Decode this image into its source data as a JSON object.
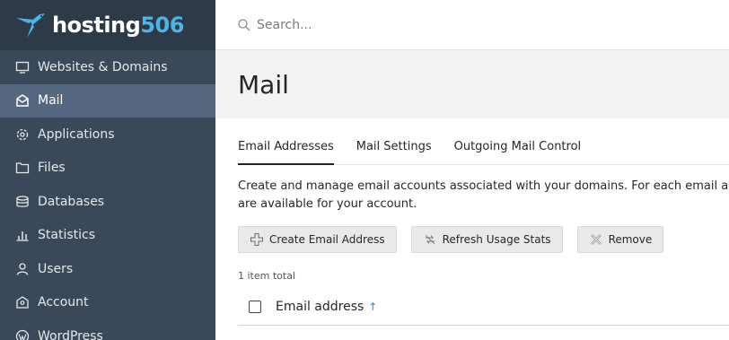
{
  "brand": {
    "name": "hosting",
    "number": "506"
  },
  "sidebar": {
    "items": [
      {
        "label": "Websites & Domains",
        "icon": "monitor-icon"
      },
      {
        "label": "Mail",
        "icon": "envelope-icon",
        "active": true
      },
      {
        "label": "Applications",
        "icon": "gear-icon"
      },
      {
        "label": "Files",
        "icon": "folder-icon"
      },
      {
        "label": "Databases",
        "icon": "database-icon"
      },
      {
        "label": "Statistics",
        "icon": "bar-chart-icon"
      },
      {
        "label": "Users",
        "icon": "user-icon"
      },
      {
        "label": "Account",
        "icon": "account-icon"
      },
      {
        "label": "WordPress",
        "icon": "wordpress-icon"
      }
    ]
  },
  "search": {
    "placeholder": "Search..."
  },
  "page": {
    "title": "Mail"
  },
  "tabs": [
    {
      "label": "Email Addresses",
      "active": true
    },
    {
      "label": "Mail Settings"
    },
    {
      "label": "Outgoing Mail Control"
    }
  ],
  "description": {
    "line1": "Create and manage email accounts associated with your domains. For each email account, you can set up mail forwarding",
    "line2": "are available for your account."
  },
  "toolbar": {
    "create_label": "Create Email Address",
    "refresh_label": "Refresh Usage Stats",
    "remove_label": "Remove"
  },
  "list": {
    "total": "1 item total",
    "column_email": "Email address",
    "sort_arrow": "↑"
  },
  "colors": {
    "sidebar_bg": "#39495a",
    "sidebar_active": "#53687f",
    "brand_accent": "#4cb5e8",
    "sort_arrow": "#2a8bd0"
  }
}
